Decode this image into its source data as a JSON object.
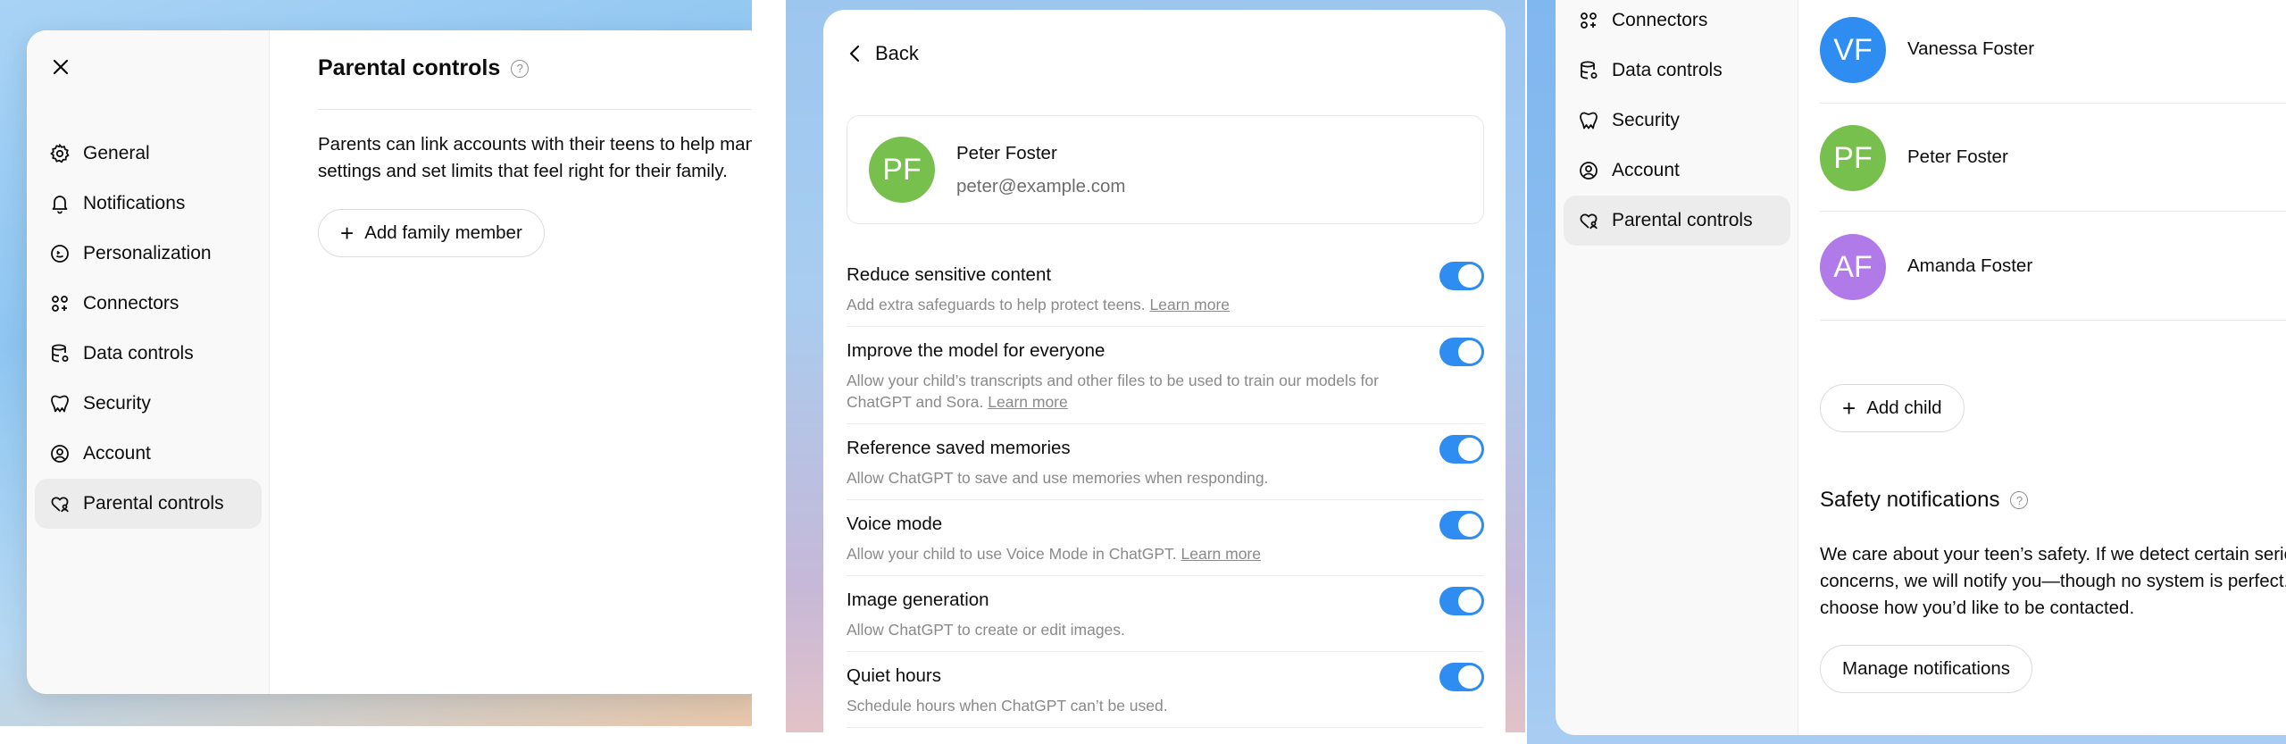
{
  "panel1": {
    "nav": [
      {
        "label": "General",
        "icon": "gear-icon"
      },
      {
        "label": "Notifications",
        "icon": "bell-icon"
      },
      {
        "label": "Personalization",
        "icon": "personalization-icon"
      },
      {
        "label": "Connectors",
        "icon": "connectors-icon"
      },
      {
        "label": "Data controls",
        "icon": "database-icon"
      },
      {
        "label": "Security",
        "icon": "shield-icon"
      },
      {
        "label": "Account",
        "icon": "user-circle-icon"
      },
      {
        "label": "Parental controls",
        "icon": "parental-icon"
      }
    ],
    "active_nav": "Parental controls",
    "title": "Parental controls",
    "help_glyph": "?",
    "description": "Parents can link accounts with their teens to help manage settings and set limits that feel right for their family.",
    "add_family_label": "Add family member"
  },
  "panel2": {
    "back_label": "Back",
    "profile": {
      "initials": "PF",
      "name": "Peter Foster",
      "email": "peter@example.com",
      "avatar_color": "#78c04e"
    },
    "settings": [
      {
        "title": "Reduce sensitive content",
        "desc": "Add extra safeguards to help protect teens.",
        "link": "Learn more",
        "enabled": true
      },
      {
        "title": "Improve the model for everyone",
        "desc": "Allow your child’s transcripts and other files to be used to train our models for ChatGPT and Sora.",
        "link": "Learn more",
        "enabled": true
      },
      {
        "title": "Reference saved memories",
        "desc": "Allow ChatGPT to save and use memories when responding.",
        "link": "",
        "enabled": true
      },
      {
        "title": "Voice mode",
        "desc": "Allow your child to use Voice Mode in ChatGPT.",
        "link": "Learn more",
        "enabled": true
      },
      {
        "title": "Image generation",
        "desc": "Allow ChatGPT to create or edit images.",
        "link": "",
        "enabled": true
      },
      {
        "title": "Quiet hours",
        "desc": "Schedule hours when ChatGPT can’t be used.",
        "link": "",
        "enabled": true
      }
    ],
    "toggle_color": "#2f8cf0"
  },
  "panel3": {
    "nav": [
      {
        "label": "Connectors",
        "icon": "connectors-icon"
      },
      {
        "label": "Data controls",
        "icon": "database-icon"
      },
      {
        "label": "Security",
        "icon": "shield-icon"
      },
      {
        "label": "Account",
        "icon": "user-circle-icon"
      },
      {
        "label": "Parental controls",
        "icon": "parental-icon"
      }
    ],
    "active_nav": "Parental controls",
    "members": [
      {
        "initials": "VF",
        "name": "Vanessa Foster",
        "color": "#2f8cf0"
      },
      {
        "initials": "PF",
        "name": "Peter Foster",
        "color": "#78c04e"
      },
      {
        "initials": "AF",
        "name": "Amanda Foster",
        "color": "#b07be8"
      }
    ],
    "add_child_label": "Add child",
    "safety_title": "Safety notifications",
    "help_glyph": "?",
    "safety_desc_lines": [
      "We care about your teen’s safety. If we detect certain serio",
      "concerns, we will notify you—though no system is perfect.",
      "choose how you’d like to be contacted."
    ],
    "manage_label": "Manage notifications"
  }
}
